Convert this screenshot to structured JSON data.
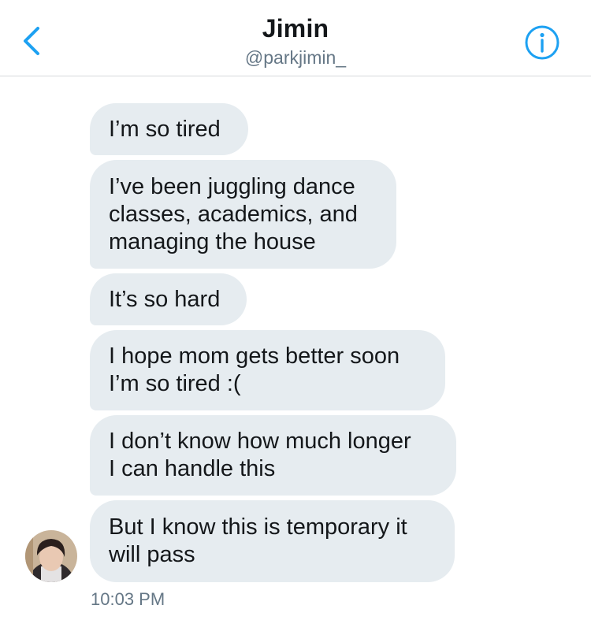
{
  "header": {
    "title": "Jimin",
    "handle": "@parkjimin_"
  },
  "messages": [
    {
      "lines": [
        "I’m so tired"
      ]
    },
    {
      "lines": [
        "I’ve been juggling dance",
        "classes, academics, and",
        "managing the house"
      ]
    },
    {
      "lines": [
        "It’s so hard"
      ]
    },
    {
      "lines": [
        "I hope mom gets better soon",
        "I’m so tired :("
      ]
    },
    {
      "lines": [
        "I don’t know how much longer",
        "I can handle this"
      ]
    },
    {
      "lines": [
        "But I know this is temporary it",
        "will pass"
      ]
    }
  ],
  "timestamp": "10:03 PM",
  "colors": {
    "accent": "#1da1f2",
    "bubble": "#e6ecf0",
    "text": "#14171a",
    "muted": "#657786"
  },
  "icons": {
    "back": "chevron-left-icon",
    "info": "info-icon"
  }
}
